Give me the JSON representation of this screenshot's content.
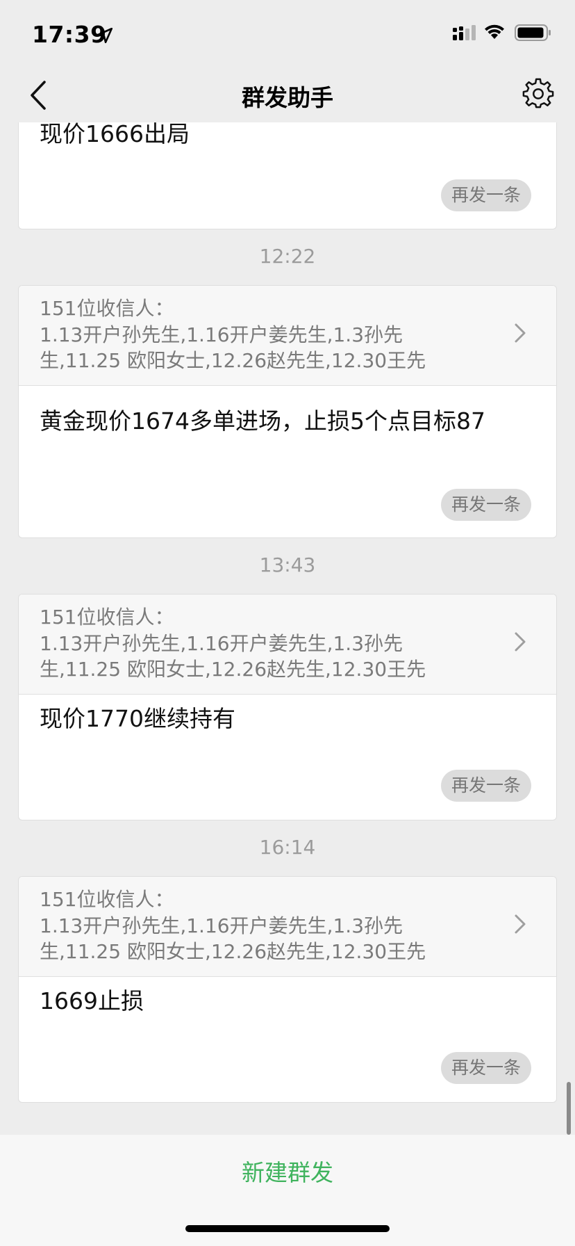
{
  "status_bar": {
    "time": "17:39"
  },
  "nav": {
    "title": "群发助手"
  },
  "top_card": {
    "text": "现价1666出局",
    "resend": "再发一条"
  },
  "groups": [
    {
      "time": "12:22",
      "recipients_count": "151位收信人：",
      "recipients_line1": "1.13开户孙先生,1.16开户姜先生,1.3孙先",
      "recipients_line2": "生,11.25 欧阳女士,12.26赵先生,12.30王先",
      "message": "黄金现价1674多单进场，止损5个点目标87",
      "resend": "再发一条"
    },
    {
      "time": "13:43",
      "recipients_count": "151位收信人：",
      "recipients_line1": "1.13开户孙先生,1.16开户姜先生,1.3孙先",
      "recipients_line2": "生,11.25 欧阳女士,12.26赵先生,12.30王先",
      "message": "现价1770继续持有",
      "resend": "再发一条"
    },
    {
      "time": "16:14",
      "recipients_count": "151位收信人：",
      "recipients_line1": "1.13开户孙先生,1.16开户姜先生,1.3孙先",
      "recipients_line2": "生,11.25 欧阳女士,12.26赵先生,12.30王先",
      "message": "1669止损",
      "resend": "再发一条"
    }
  ],
  "bottom": {
    "new_broadcast": "新建群发"
  },
  "colors": {
    "accent": "#3fb35d",
    "background": "#ededed"
  }
}
